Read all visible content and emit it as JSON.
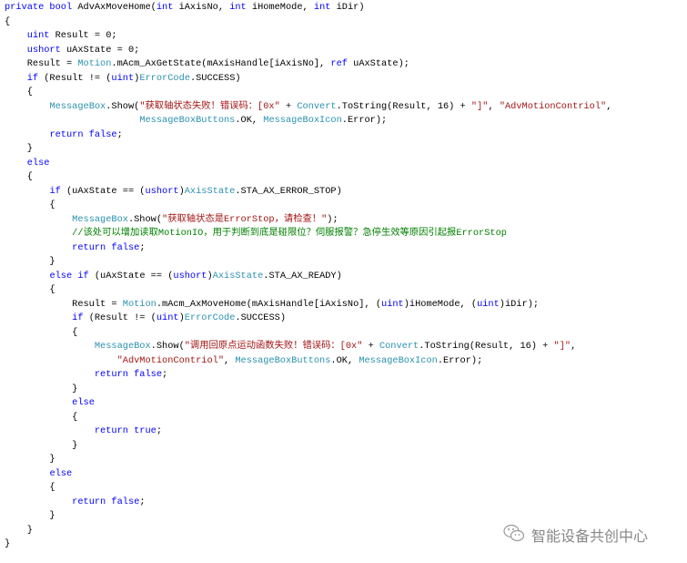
{
  "colors": {
    "keyword": "#0000ff",
    "type": "#2b91af",
    "string": "#a31515",
    "comment": "#008000"
  },
  "code_lines": [
    [
      [
        "private bool",
        "kw"
      ],
      [
        " AdvAxMoveHome(",
        ""
      ],
      [
        "int",
        "kw"
      ],
      [
        " iAxisNo, ",
        ""
      ],
      [
        "int",
        "kw"
      ],
      [
        " iHomeMode, ",
        ""
      ],
      [
        "int",
        "kw"
      ],
      [
        " iDir)",
        ""
      ]
    ],
    [
      [
        "{",
        ""
      ]
    ],
    [
      [
        "    ",
        ""
      ],
      [
        "uint",
        "kw"
      ],
      [
        " Result = 0;",
        ""
      ]
    ],
    [
      [
        "    ",
        ""
      ],
      [
        "ushort",
        "kw"
      ],
      [
        " uAxState = 0;",
        ""
      ]
    ],
    [
      [
        "    Result = ",
        ""
      ],
      [
        "Motion",
        "ty"
      ],
      [
        ".mAcm_AxGetState(mAxisHandle[iAxisNo], ",
        ""
      ],
      [
        "ref",
        "kw"
      ],
      [
        " uAxState);",
        ""
      ]
    ],
    [
      [
        "    ",
        ""
      ],
      [
        "if",
        "kw"
      ],
      [
        " (Result != (",
        ""
      ],
      [
        "uint",
        "kw"
      ],
      [
        ")",
        ""
      ],
      [
        "ErrorCode",
        "ty"
      ],
      [
        ".SUCCESS)",
        ""
      ]
    ],
    [
      [
        "    {",
        ""
      ]
    ],
    [
      [
        "        ",
        ""
      ],
      [
        "MessageBox",
        "ty"
      ],
      [
        ".Show(",
        ""
      ],
      [
        "\"获取轴状态失败！错误码：[0x\"",
        "str"
      ],
      [
        " + ",
        ""
      ],
      [
        "Convert",
        "ty"
      ],
      [
        ".ToString(Result, 16) + ",
        ""
      ],
      [
        "\"]\"",
        "str"
      ],
      [
        ", ",
        ""
      ],
      [
        "\"AdvMotionContriol\"",
        "str"
      ],
      [
        ",",
        ""
      ]
    ],
    [
      [
        "                        ",
        ""
      ],
      [
        "MessageBoxButtons",
        "ty"
      ],
      [
        ".OK, ",
        ""
      ],
      [
        "MessageBoxIcon",
        "ty"
      ],
      [
        ".Error);",
        ""
      ]
    ],
    [
      [
        "        ",
        ""
      ],
      [
        "return false",
        "kw"
      ],
      [
        ";",
        ""
      ]
    ],
    [
      [
        "    }",
        ""
      ]
    ],
    [
      [
        "    ",
        ""
      ],
      [
        "else",
        "kw"
      ]
    ],
    [
      [
        "    {",
        ""
      ]
    ],
    [
      [
        "        ",
        ""
      ],
      [
        "if",
        "kw"
      ],
      [
        " (uAxState == (",
        ""
      ],
      [
        "ushort",
        "kw"
      ],
      [
        ")",
        ""
      ],
      [
        "AxisState",
        "ty"
      ],
      [
        ".STA_AX_ERROR_STOP)",
        ""
      ]
    ],
    [
      [
        "        {",
        ""
      ]
    ],
    [
      [
        "            ",
        ""
      ],
      [
        "MessageBox",
        "ty"
      ],
      [
        ".Show(",
        ""
      ],
      [
        "\"获取轴状态是ErrorStop，请检查！\"",
        "str"
      ],
      [
        ");",
        ""
      ]
    ],
    [
      [
        "            ",
        ""
      ],
      [
        "//该处可以增加读取MotionIO，用于判断到底是碰限位？伺服报警？急停生效等原因引起报ErrorStop",
        "cm"
      ]
    ],
    [
      [
        "            ",
        ""
      ],
      [
        "return false",
        "kw"
      ],
      [
        ";",
        ""
      ]
    ],
    [
      [
        "        }",
        ""
      ]
    ],
    [
      [
        "        ",
        ""
      ],
      [
        "else if",
        "kw"
      ],
      [
        " (uAxState == (",
        ""
      ],
      [
        "ushort",
        "kw"
      ],
      [
        ")",
        ""
      ],
      [
        "AxisState",
        "ty"
      ],
      [
        ".STA_AX_READY)",
        ""
      ]
    ],
    [
      [
        "        {",
        ""
      ]
    ],
    [
      [
        "            Result = ",
        ""
      ],
      [
        "Motion",
        "ty"
      ],
      [
        ".mAcm_AxMoveHome(mAxisHandle[iAxisNo], (",
        ""
      ],
      [
        "uint",
        "kw"
      ],
      [
        ")iHomeMode, (",
        ""
      ],
      [
        "uint",
        "kw"
      ],
      [
        ")iDir);",
        ""
      ]
    ],
    [
      [
        "            ",
        ""
      ],
      [
        "if",
        "kw"
      ],
      [
        " (Result != (",
        ""
      ],
      [
        "uint",
        "kw"
      ],
      [
        ")",
        ""
      ],
      [
        "ErrorCode",
        "ty"
      ],
      [
        ".SUCCESS)",
        ""
      ]
    ],
    [
      [
        "            {",
        ""
      ]
    ],
    [
      [
        "                ",
        ""
      ],
      [
        "MessageBox",
        "ty"
      ],
      [
        ".Show(",
        ""
      ],
      [
        "\"调用回原点运动函数失败！错误码：[0x\"",
        "str"
      ],
      [
        " + ",
        ""
      ],
      [
        "Convert",
        "ty"
      ],
      [
        ".ToString(Result, 16) + ",
        ""
      ],
      [
        "\"]\"",
        "str"
      ],
      [
        ",",
        ""
      ]
    ],
    [
      [
        "                    ",
        ""
      ],
      [
        "\"AdvMotionContriol\"",
        "str"
      ],
      [
        ", ",
        ""
      ],
      [
        "MessageBoxButtons",
        "ty"
      ],
      [
        ".OK, ",
        ""
      ],
      [
        "MessageBoxIcon",
        "ty"
      ],
      [
        ".Error);",
        ""
      ]
    ],
    [
      [
        "                ",
        ""
      ],
      [
        "return false",
        "kw"
      ],
      [
        ";",
        ""
      ]
    ],
    [
      [
        "            }",
        ""
      ]
    ],
    [
      [
        "            ",
        ""
      ],
      [
        "else",
        "kw"
      ]
    ],
    [
      [
        "            {",
        ""
      ]
    ],
    [
      [
        "                ",
        ""
      ],
      [
        "return true",
        "kw"
      ],
      [
        ";",
        ""
      ]
    ],
    [
      [
        "            }",
        ""
      ]
    ],
    [
      [
        "        }",
        ""
      ]
    ],
    [
      [
        "        ",
        ""
      ],
      [
        "else",
        "kw"
      ]
    ],
    [
      [
        "        {",
        ""
      ]
    ],
    [
      [
        "            ",
        ""
      ],
      [
        "return false",
        "kw"
      ],
      [
        ";",
        ""
      ]
    ],
    [
      [
        "        }",
        ""
      ]
    ],
    [
      [
        "    }",
        ""
      ]
    ],
    [
      [
        "}",
        ""
      ]
    ]
  ],
  "watermark": {
    "icon": "wechat-icon",
    "text": "智能设备共创中心"
  }
}
